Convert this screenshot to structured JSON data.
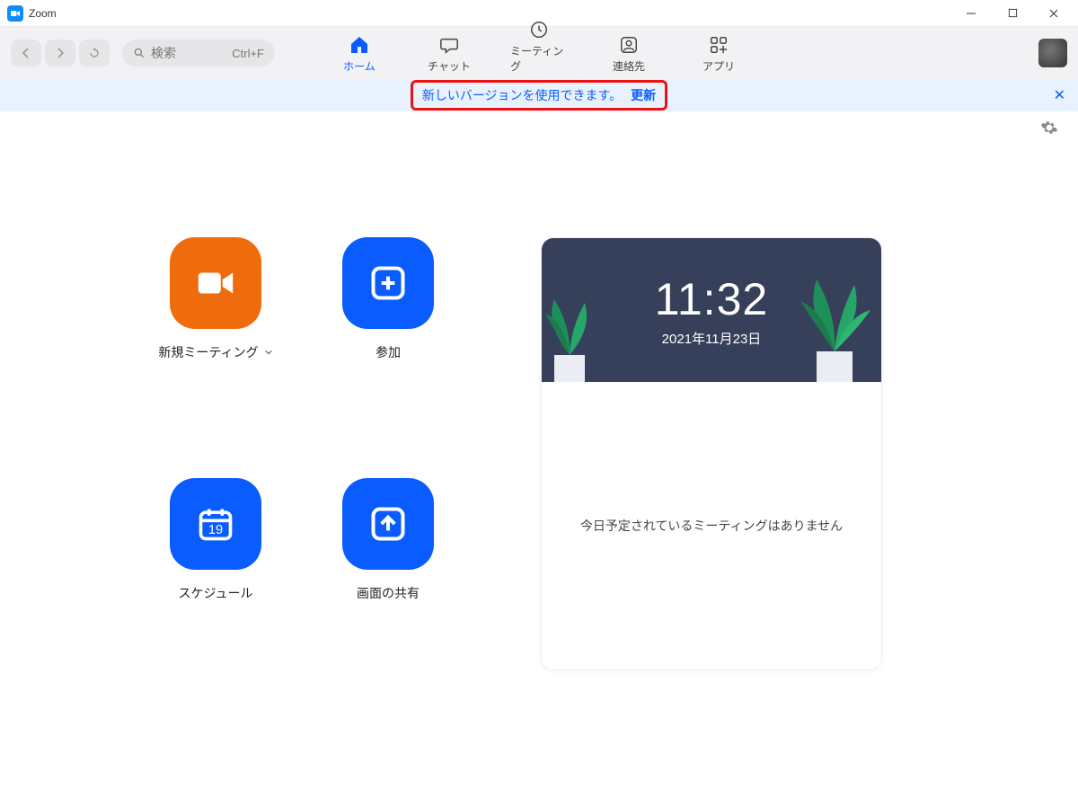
{
  "title": "Zoom",
  "search": {
    "placeholder": "検索",
    "shortcut": "Ctrl+F"
  },
  "tabs": {
    "home": "ホーム",
    "chat": "チャット",
    "meetings": "ミーティング",
    "contacts": "連絡先",
    "apps": "アプリ"
  },
  "banner": {
    "message": "新しいバージョンを使用できます。",
    "update": "更新"
  },
  "actions": {
    "new_meeting": "新規ミーティング",
    "join": "参加",
    "schedule": "スケジュール",
    "share": "画面の共有",
    "calendar_day": "19"
  },
  "panel": {
    "time": "11:32",
    "date": "2021年11月23日",
    "empty": "今日予定されているミーティングはありません"
  }
}
